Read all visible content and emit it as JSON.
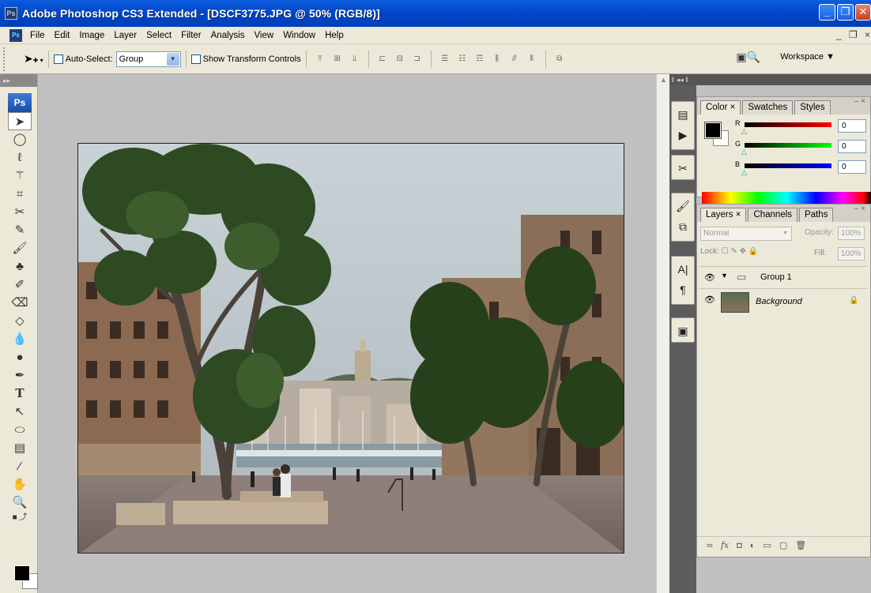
{
  "window": {
    "title": "Adobe Photoshop CS3 Extended - [DSCF3775.JPG @ 50% (RGB/8)]",
    "app_icon": "Ps"
  },
  "menu": {
    "items": [
      "File",
      "Edit",
      "Image",
      "Layer",
      "Select",
      "Filter",
      "Analysis",
      "View",
      "Window",
      "Help"
    ]
  },
  "options": {
    "auto_select_label": "Auto-Select:",
    "auto_select_value": "Group",
    "show_transform_label": "Show Transform Controls",
    "workspace_label": "Workspace ▼"
  },
  "toolbox": {
    "logo": "Ps"
  },
  "color_panel": {
    "tabs": [
      "Color ×",
      "Swatches",
      "Styles"
    ],
    "channels": [
      {
        "label": "R",
        "value": "0",
        "color": "#e00000"
      },
      {
        "label": "G",
        "value": "0",
        "color": "#00c000"
      },
      {
        "label": "B",
        "value": "0",
        "color": "#0000e0"
      }
    ]
  },
  "layers_panel": {
    "tabs": [
      "Layers ×",
      "Channels",
      "Paths"
    ],
    "blend_mode": "Normal",
    "opacity_label": "Opacity:",
    "opacity_value": "100%",
    "lock_label": "Lock:",
    "fill_label": "Fill:",
    "fill_value": "100%",
    "layers": [
      {
        "name": "Group 1",
        "type": "group"
      },
      {
        "name": "Background",
        "type": "image",
        "locked": true
      }
    ]
  },
  "colors": {
    "titlebar": "#0046c8",
    "chrome": "#ece9d8",
    "workspace": "#c0c0c0"
  }
}
